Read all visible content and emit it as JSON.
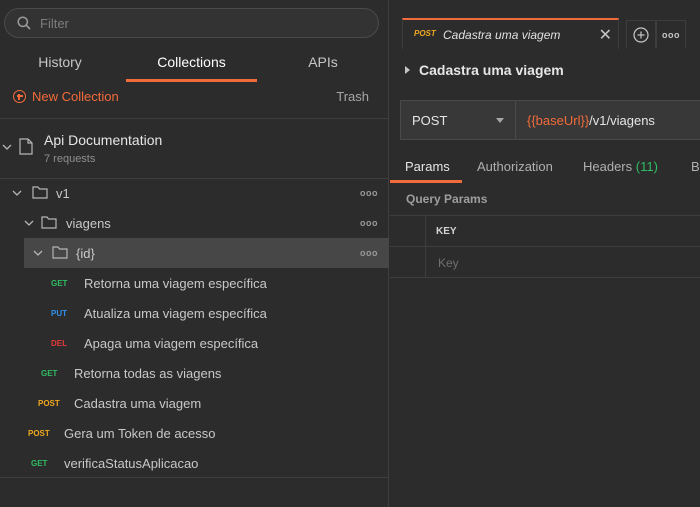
{
  "search": {
    "placeholder": "Filter"
  },
  "sidebar_tabs": [
    "History",
    "Collections",
    "APIs"
  ],
  "active_sidebar_tab": "Collections",
  "toolbar": {
    "new_collection": "New Collection",
    "trash": "Trash"
  },
  "collection": {
    "name": "Api Documentation",
    "requests": "7 requests"
  },
  "tree": {
    "folder_v1": "v1",
    "folder_viagens": "viagens",
    "folder_id": "{id}",
    "items": [
      {
        "method": "GET",
        "name": "Retorna uma viagem específica"
      },
      {
        "method": "PUT",
        "name": "Atualiza uma viagem específica"
      },
      {
        "method": "DEL",
        "name": "Apaga uma viagem específica"
      },
      {
        "method": "GET",
        "name": "Retorna todas as viagens"
      },
      {
        "method": "POST",
        "name": "Cadastra uma viagem"
      },
      {
        "method": "POST",
        "name": "Gera um Token de acesso"
      },
      {
        "method": "GET",
        "name": "verificaStatusAplicacao"
      }
    ],
    "more": "ooo"
  },
  "request_tab": {
    "method": "POST",
    "title": "Cadastra uma viagem"
  },
  "request": {
    "name": "Cadastra uma viagem",
    "method": "POST",
    "url_var": "{{baseUrl}}",
    "url_path": "/v1/viagens"
  },
  "sub_tabs": {
    "params": "Params",
    "authorization": "Authorization",
    "headers": "Headers",
    "headers_count": "(11)",
    "body": "B"
  },
  "query_params": {
    "title": "Query Params",
    "key_header": "KEY",
    "key_placeholder": "Key"
  },
  "colors": {
    "accent": "#f26b3a",
    "get": "#2fbd63",
    "put": "#2f8fe8",
    "del": "#e63a3a",
    "post": "#f0a820"
  }
}
